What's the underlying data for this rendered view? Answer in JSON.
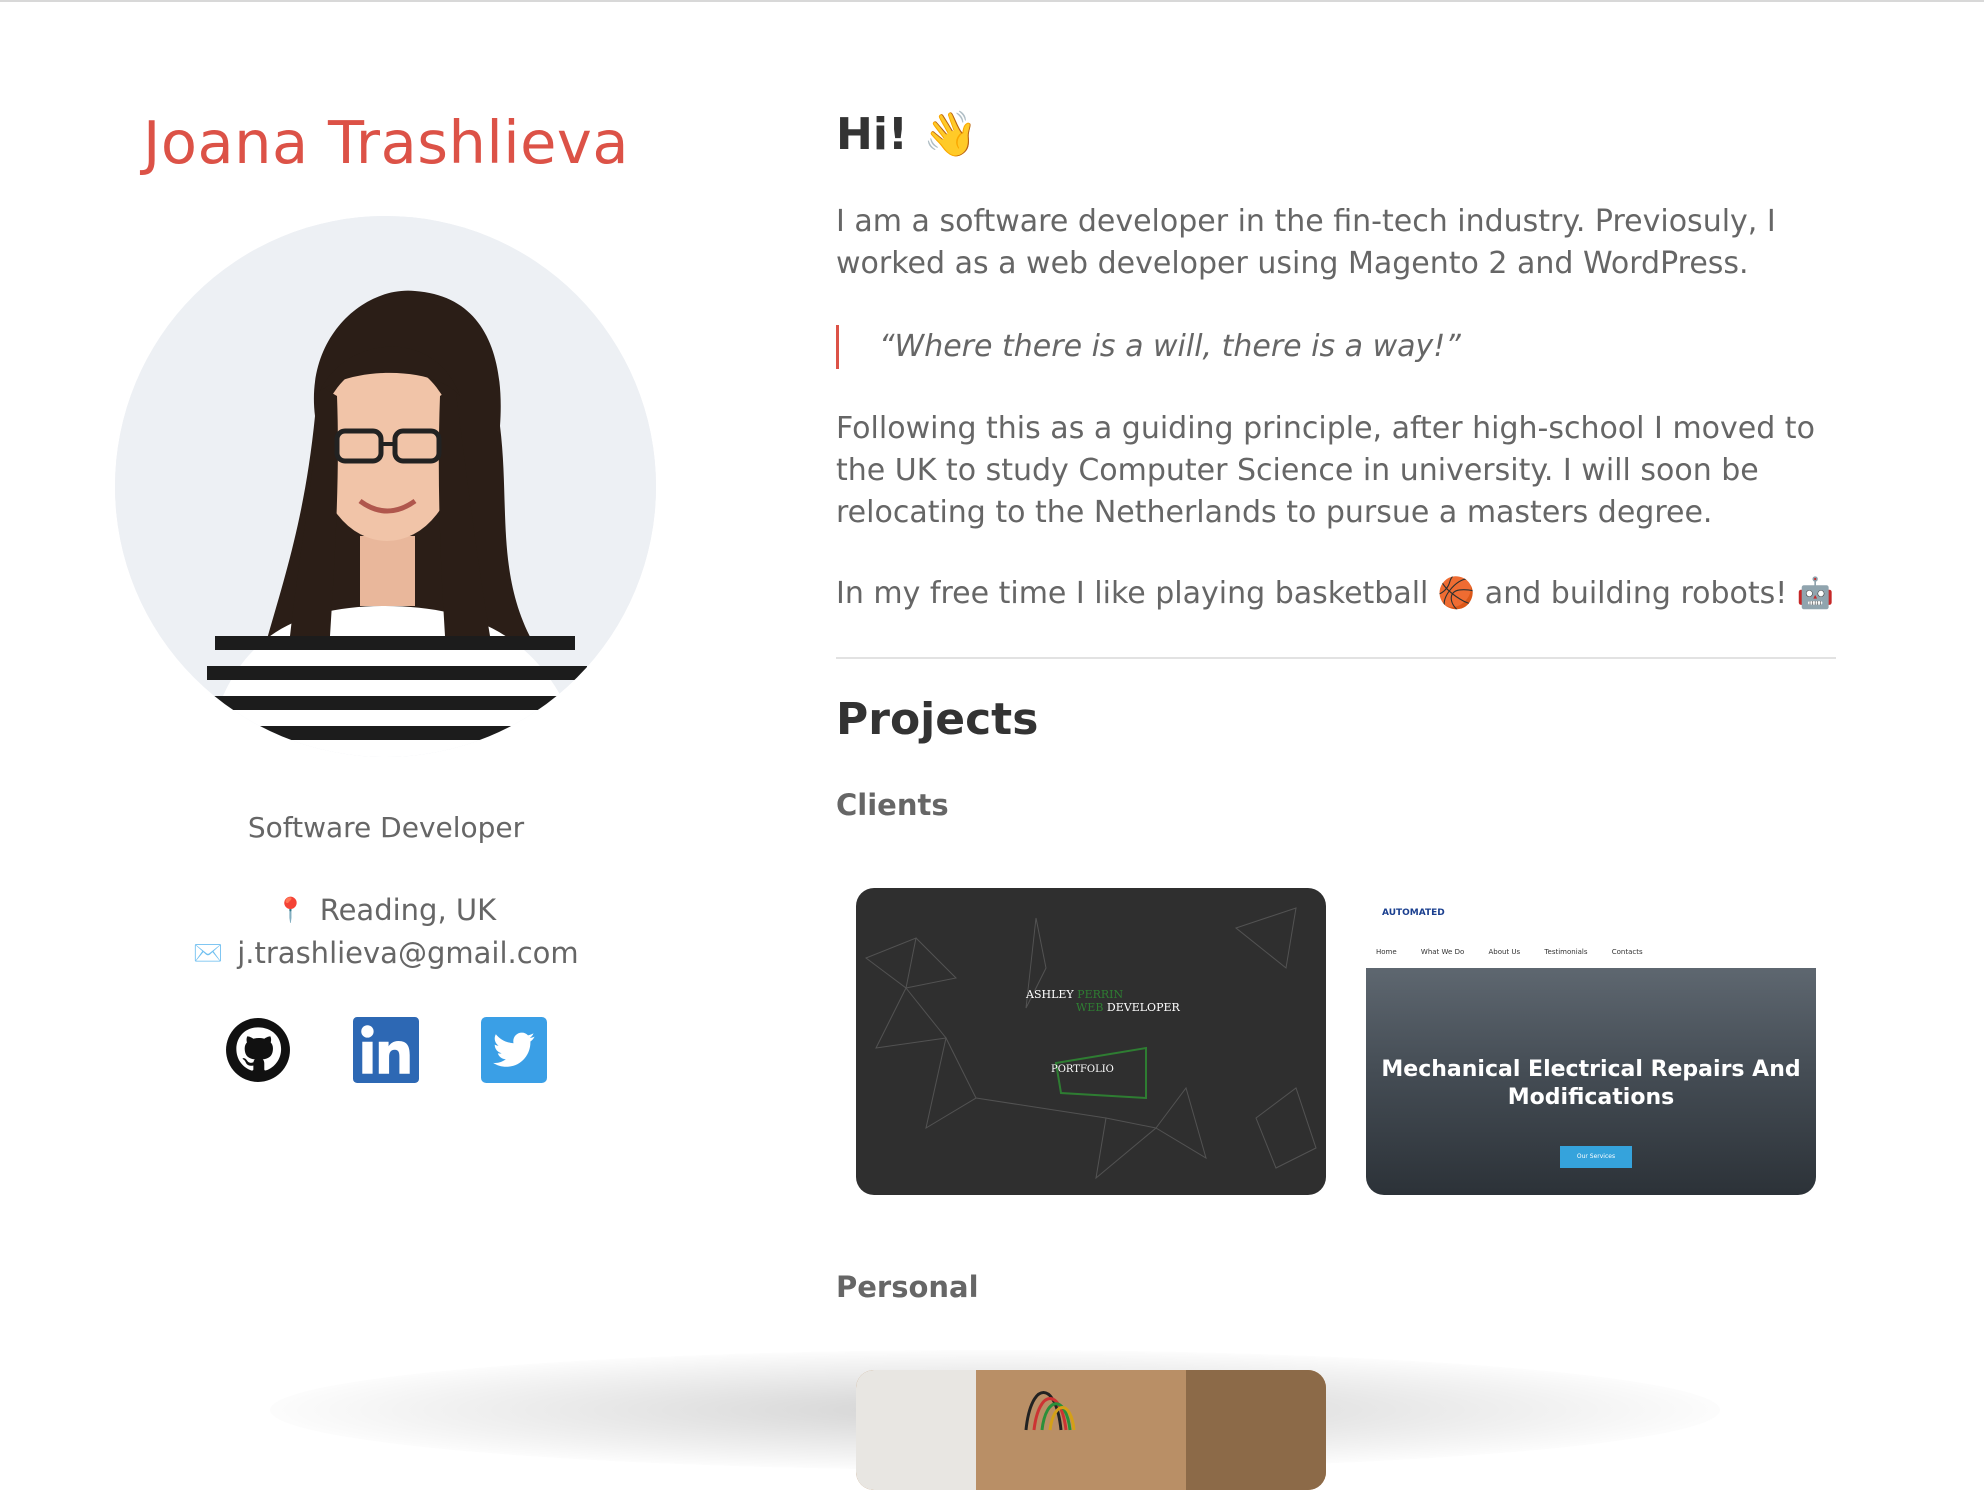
{
  "profile": {
    "name": "Joana Trashlieva",
    "role": "Software Developer",
    "location": "Reading, UK",
    "email": "j.trashlieva@gmail.com",
    "location_emoji": "📍",
    "email_emoji": "✉️",
    "socials": [
      {
        "name": "github-icon",
        "color": "#111111"
      },
      {
        "name": "linkedin-icon",
        "color": "#2d68b4"
      },
      {
        "name": "twitter-icon",
        "color": "#3a9fe6"
      }
    ]
  },
  "about": {
    "greeting": "Hi! 👋",
    "intro": "I am a software developer in the fin-tech industry. Previosuly, I worked as a web developer using Magento 2 and WordPress.",
    "quote": "“Where there is a will, there is a way!”",
    "paragraph": "Following this as a guiding principle, after high-school I moved to the UK to study Computer Science in university. I will soon be relocating to the Netherlands to pursue a masters degree.",
    "hobbies": "In my free time I like playing basketball 🏀  and building robots! 🤖"
  },
  "projects": {
    "heading": "Projects",
    "clients_heading": "Clients",
    "personal_heading": "Personal",
    "client_cards": [
      {
        "name_part1": "ASHLEY ",
        "name_part2": "PERRIN",
        "name_part3": "WEB",
        "name_part4": " DEVELOPER",
        "button": "PORTFOLIO"
      },
      {
        "logo": "AUTOMATED",
        "nav": [
          "Home",
          "What We Do",
          "About Us",
          "Testimonials",
          "Contacts"
        ],
        "title": "Mechanical Electrical Repairs And Modifications",
        "button": "Our Services"
      }
    ]
  },
  "colors": {
    "accent": "#dc5247",
    "text": "#666666",
    "heading": "#333333"
  }
}
